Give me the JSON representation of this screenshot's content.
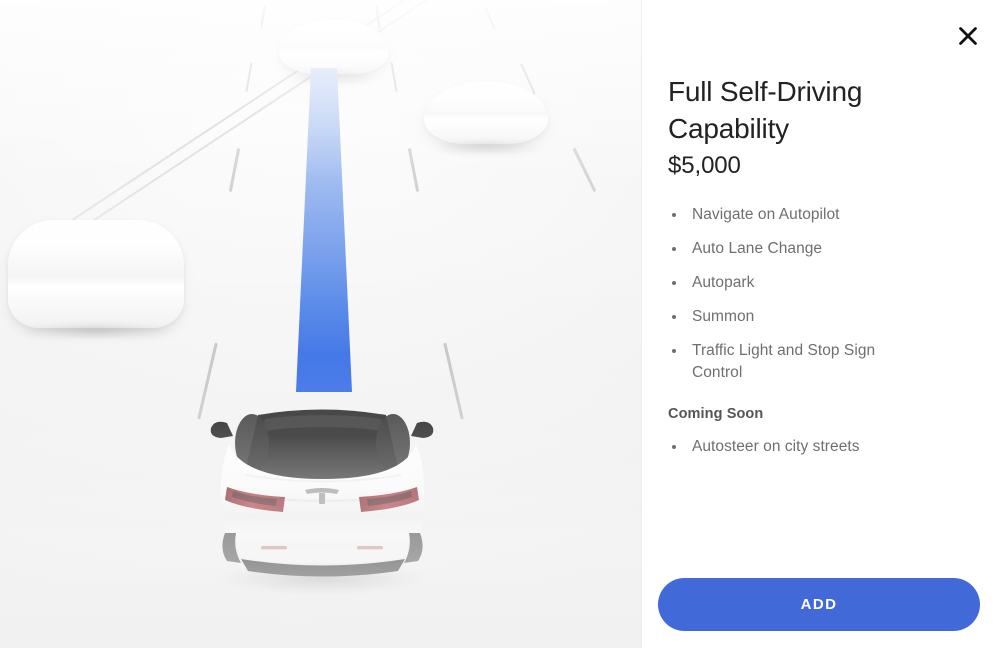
{
  "panel": {
    "title": "Full Self-Driving Capability",
    "price": "$5,000",
    "close_icon": "close-icon",
    "features": [
      "Navigate on Autopilot",
      "Auto Lane Change",
      "Autopark",
      "Summon",
      "Traffic Light and Stop Sign Control"
    ],
    "coming_soon_label": "Coming Soon",
    "coming_soon_features": [
      "Autosteer on city streets"
    ],
    "add_button_label": "ADD"
  },
  "visualization": {
    "name": "autopilot-road-visualization",
    "ego_vehicle": "tesla-model-3-rear-view",
    "path_color_near": "#3B6FE8",
    "path_color_far": "#BBD0F5",
    "surrounding_vehicles": 3,
    "road_background": "#F4F4F4",
    "lane_marking_color": "#CCCCCC",
    "road_edge_color": "#D8D8D8"
  },
  "colors": {
    "accent": "#4169D8",
    "title_text": "#222222",
    "body_text": "#6F6F6F",
    "coming_soon_text": "#555555",
    "panel_background": "#FFFFFF"
  }
}
